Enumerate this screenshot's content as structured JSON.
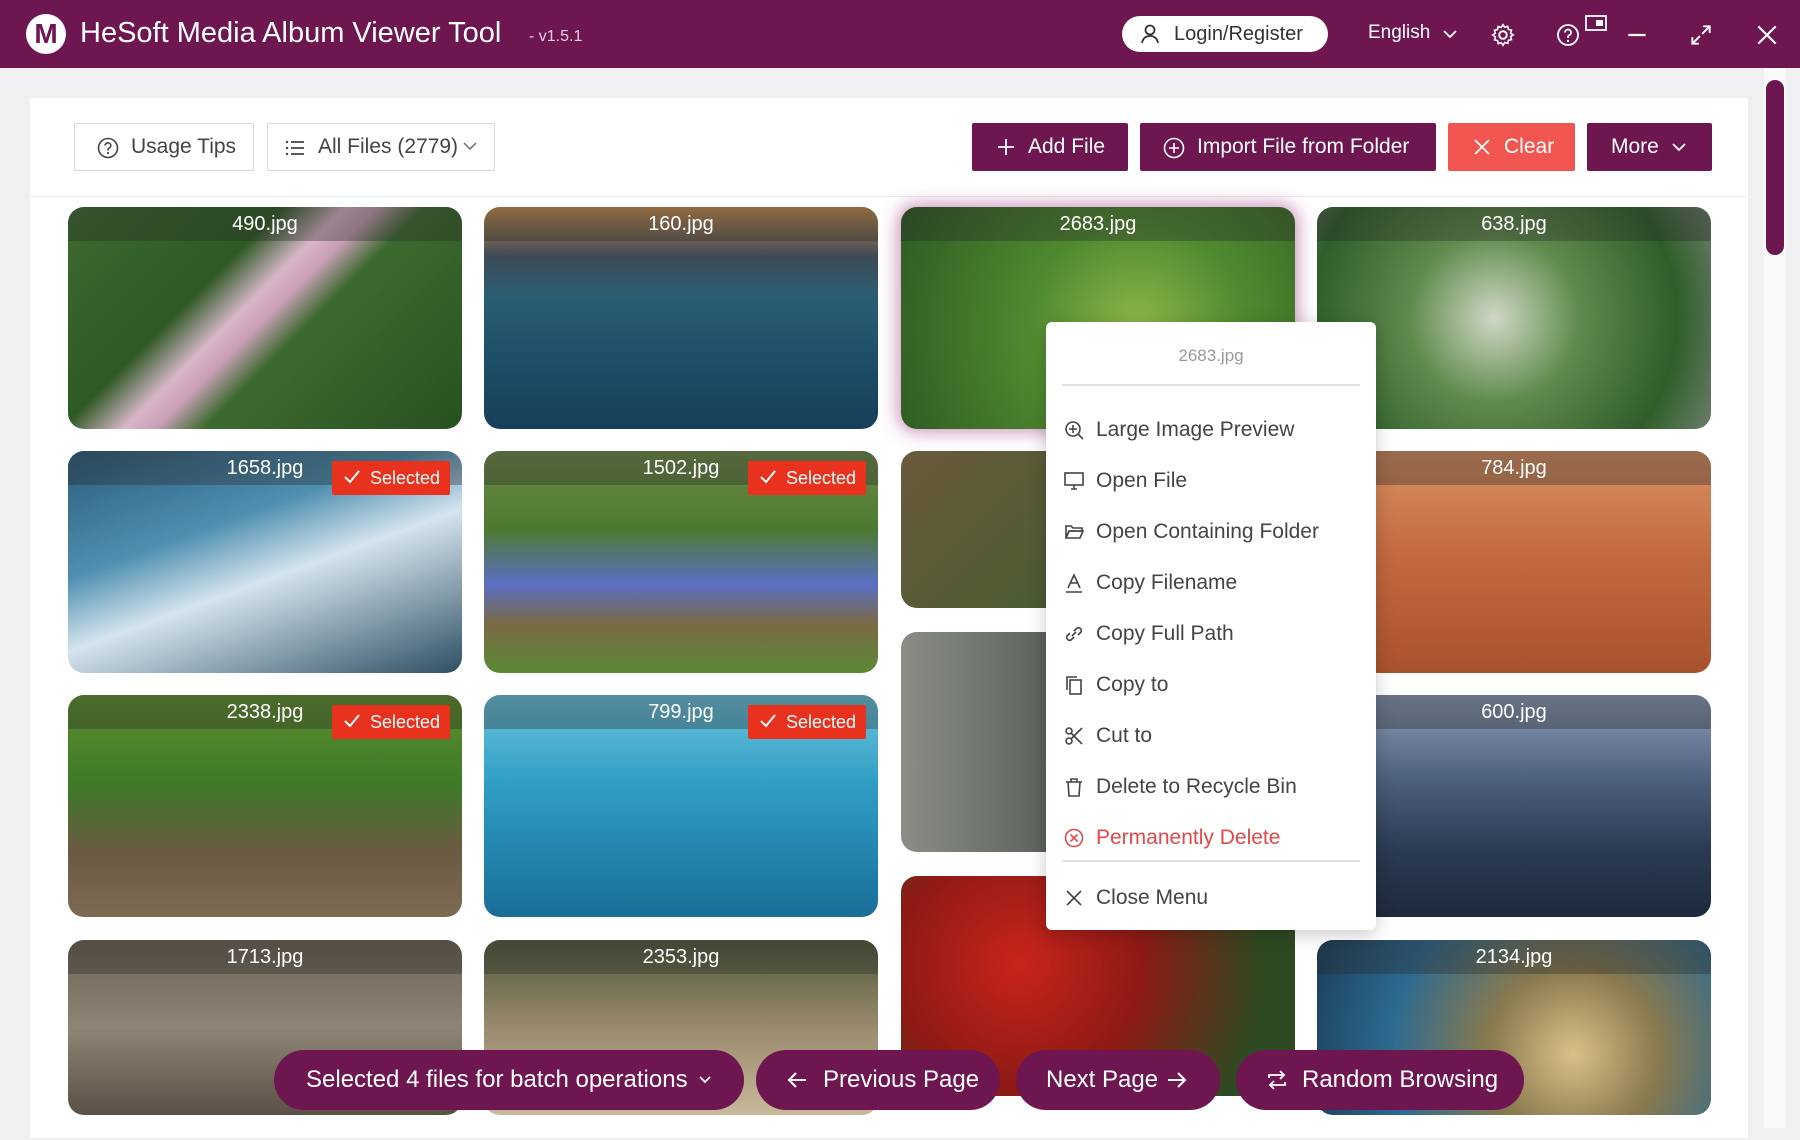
{
  "app": {
    "logo_letter": "M",
    "title": "HeSoft Media Album Viewer Tool",
    "version": "- v1.5.1",
    "login_label": "Login/Register",
    "language": "English"
  },
  "toolbar": {
    "usage_tips": "Usage Tips",
    "file_filter": "All Files (2779)",
    "add_file": "Add File",
    "import_folder": "Import File from Folder",
    "clear": "Clear",
    "more": "More"
  },
  "tiles": [
    {
      "name": "490.jpg",
      "selected": false
    },
    {
      "name": "160.jpg",
      "selected": false
    },
    {
      "name": "2683.jpg",
      "selected": false,
      "focused": true
    },
    {
      "name": "638.jpg",
      "selected": false
    },
    {
      "name": "1658.jpg",
      "selected": true
    },
    {
      "name": "1502.jpg",
      "selected": true
    },
    {
      "name": "",
      "selected": false
    },
    {
      "name": "784.jpg",
      "selected": false
    },
    {
      "name": "2338.jpg",
      "selected": true
    },
    {
      "name": "799.jpg",
      "selected": true
    },
    {
      "name": "",
      "selected": false
    },
    {
      "name": "600.jpg",
      "selected": false
    },
    {
      "name": "1713.jpg",
      "selected": false
    },
    {
      "name": "2353.jpg",
      "selected": false
    },
    {
      "name": "",
      "selected": false
    },
    {
      "name": "2134.jpg",
      "selected": false
    }
  ],
  "selected_badge": "Selected",
  "context_menu": {
    "title": "2683.jpg",
    "items": [
      {
        "label": "Large Image Preview",
        "icon": "zoom-in-icon"
      },
      {
        "label": "Open File",
        "icon": "monitor-icon"
      },
      {
        "label": "Open Containing Folder",
        "icon": "folder-open-icon"
      },
      {
        "label": "Copy Filename",
        "icon": "text-a-icon"
      },
      {
        "label": "Copy Full Path",
        "icon": "link-icon"
      },
      {
        "label": "Copy to",
        "icon": "copy-icon"
      },
      {
        "label": "Cut to",
        "icon": "scissors-icon"
      },
      {
        "label": "Delete to Recycle Bin",
        "icon": "trash-icon"
      },
      {
        "label": "Permanently Delete",
        "icon": "x-circle-icon",
        "danger": true
      }
    ],
    "close": "Close Menu"
  },
  "bottom_bar": {
    "batch": "Selected 4 files for batch operations",
    "prev": "Previous Page",
    "next": "Next Page",
    "random": "Random Browsing"
  },
  "colors": {
    "brand": "#6e1650",
    "danger": "#f0564f",
    "selected_badge": "#e8321e"
  }
}
